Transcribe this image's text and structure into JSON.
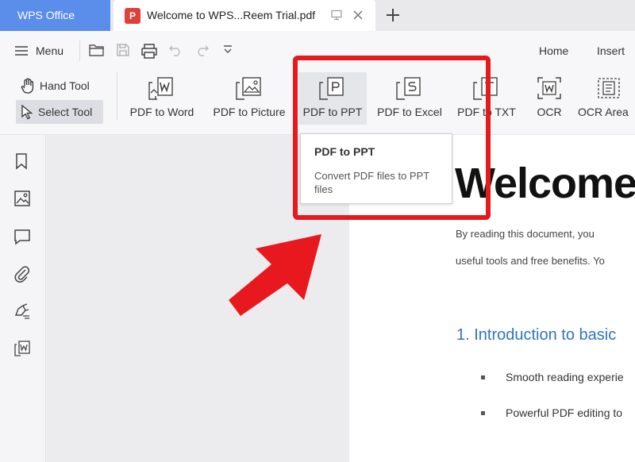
{
  "titlebar": {
    "brand": "WPS Office",
    "doc_tab_title": "Welcome to WPS...Reem Trial.pdf",
    "pdf_badge": "P"
  },
  "toolbar": {
    "menu_label": "Menu",
    "ribbon_tabs": [
      "Home",
      "Insert"
    ],
    "hand_tool": "Hand Tool",
    "select_tool": "Select Tool",
    "buttons": [
      {
        "label": "PDF to Word",
        "icon": "pdf-to-word-icon"
      },
      {
        "label": "PDF to Picture",
        "icon": "pdf-to-picture-icon"
      },
      {
        "label": "PDF to PPT",
        "icon": "pdf-to-ppt-icon"
      },
      {
        "label": "PDF to Excel",
        "icon": "pdf-to-excel-icon"
      },
      {
        "label": "PDF to TXT",
        "icon": "pdf-to-txt-icon"
      },
      {
        "label": "OCR",
        "icon": "ocr-icon"
      },
      {
        "label": "OCR Area",
        "icon": "ocr-area-icon"
      }
    ]
  },
  "tooltip": {
    "title": "PDF to PPT",
    "description": "Convert PDF files to PPT files"
  },
  "document": {
    "heading_large": "Welcome",
    "para_line1": "By reading this document, you",
    "para_line2": "useful tools and free benefits. Yo",
    "section_heading": "1. Introduction to basic",
    "bullets": [
      "Smooth reading experie",
      "Powerful PDF editing to"
    ]
  },
  "colors": {
    "brand_blue": "#5b8dea",
    "annotation_red": "#e8191e",
    "heading_blue": "#2f74c0"
  }
}
